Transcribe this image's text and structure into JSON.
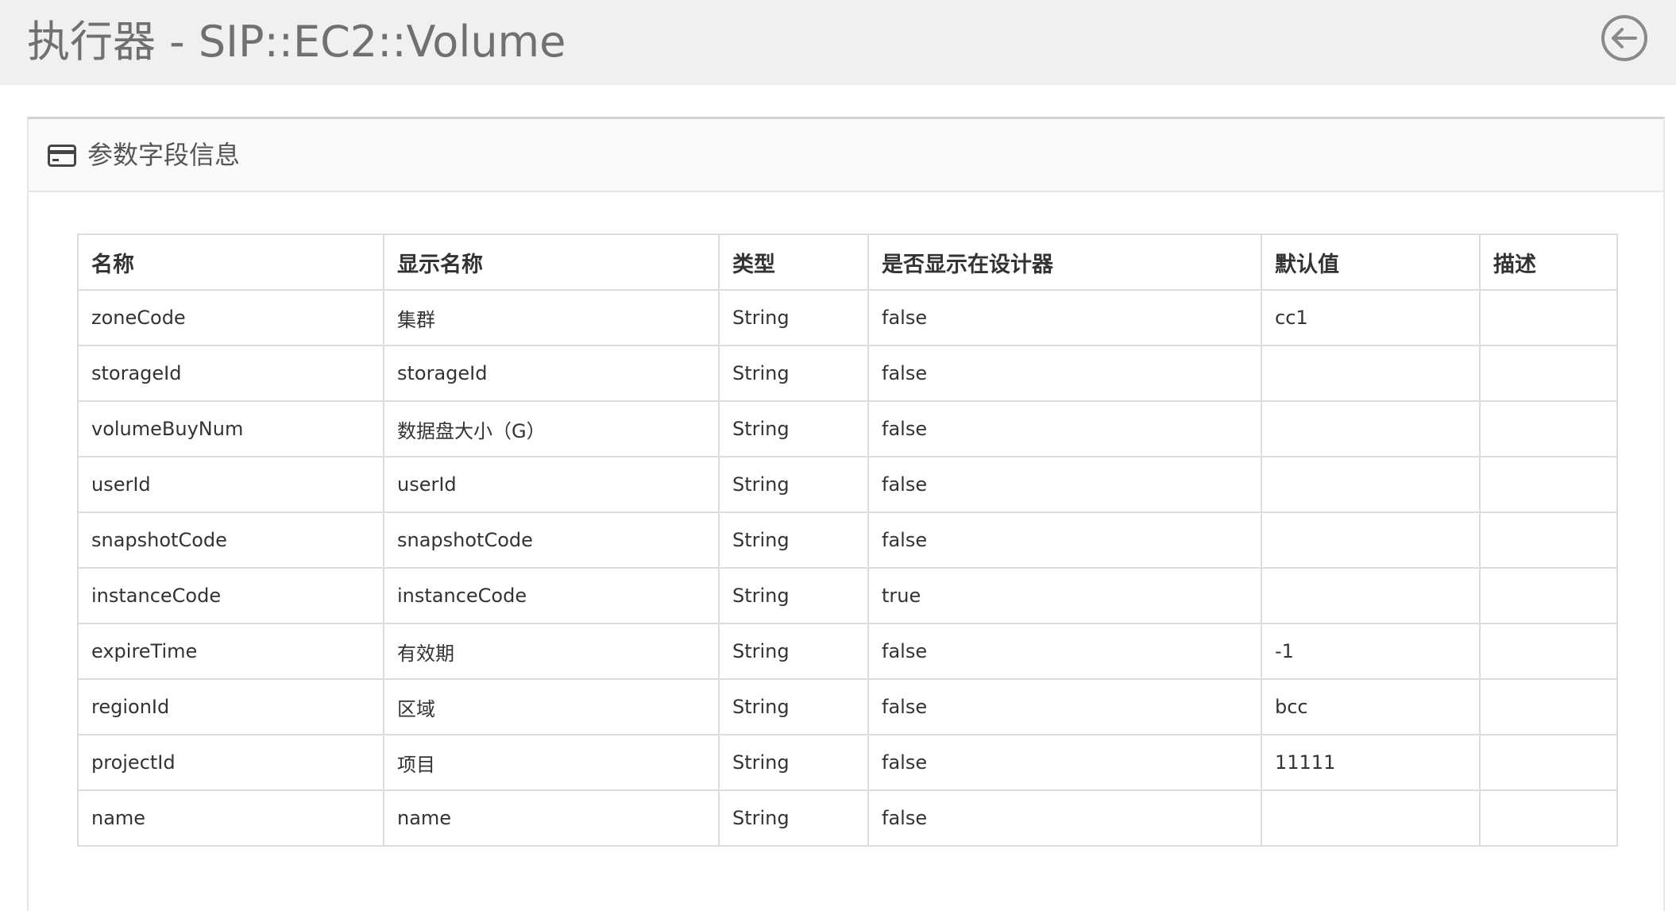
{
  "header": {
    "title": "执行器 - SIP::EC2::Volume",
    "back_icon": "arrow-left-circle-icon"
  },
  "panel": {
    "icon": "credit-card-icon",
    "title": "参数字段信息"
  },
  "table": {
    "columns": [
      "名称",
      "显示名称",
      "类型",
      "是否显示在设计器",
      "默认值",
      "描述"
    ],
    "rows": [
      [
        "zoneCode",
        "集群",
        "String",
        "false",
        "cc1",
        ""
      ],
      [
        "storageId",
        "storageId",
        "String",
        "false",
        "",
        ""
      ],
      [
        "volumeBuyNum",
        "数据盘大小（G）",
        "String",
        "false",
        "",
        ""
      ],
      [
        "userId",
        "userId",
        "String",
        "false",
        "",
        ""
      ],
      [
        "snapshotCode",
        "snapshotCode",
        "String",
        "false",
        "",
        ""
      ],
      [
        "instanceCode",
        "instanceCode",
        "String",
        "true",
        "",
        ""
      ],
      [
        "expireTime",
        "有效期",
        "String",
        "false",
        "-1",
        ""
      ],
      [
        "regionId",
        "区域",
        "String",
        "false",
        "bcc",
        ""
      ],
      [
        "projectId",
        "项目",
        "String",
        "false",
        "11111",
        ""
      ],
      [
        "name",
        "name",
        "String",
        "false",
        "",
        ""
      ]
    ]
  }
}
